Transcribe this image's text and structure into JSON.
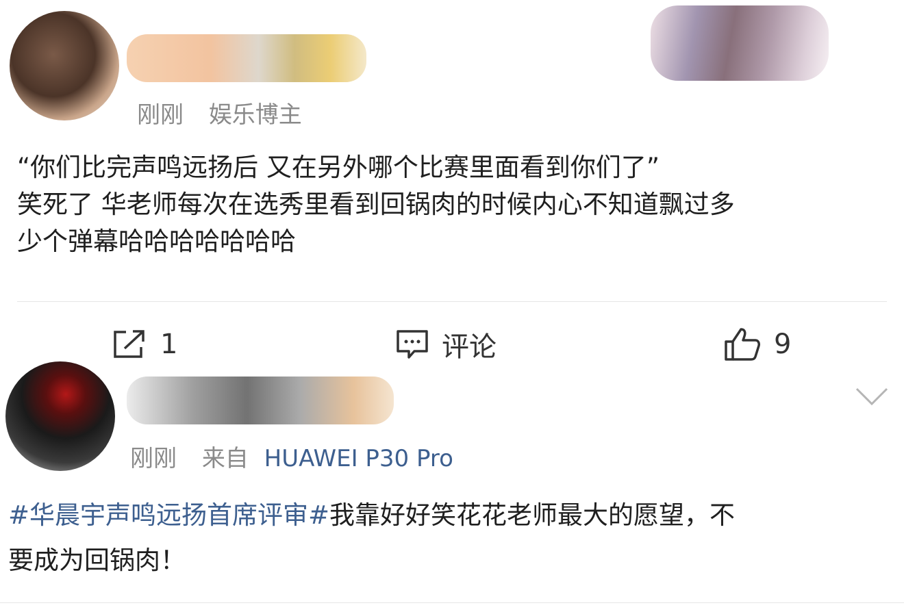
{
  "post1": {
    "meta_time": "刚刚",
    "meta_tag": "娱乐博主",
    "line1": "“你们比完声鸣远扬后 又在另外哪个比赛里面看到你们了”",
    "line2": "笑死了 华老师每次在选秀里看到回锅肉的时候内心不知道飘过多",
    "line3": "少个弹幕哈哈哈哈哈哈哈"
  },
  "actions": {
    "repost_count": "1",
    "comment_label": "评论",
    "like_count": "9"
  },
  "post2": {
    "meta_time": "刚刚",
    "meta_from": "来自",
    "meta_device": "HUAWEI P30 Pro",
    "topic": "#华晨宇声鸣远扬首席评审#",
    "text_after_topic": "我靠好好笑花花老师最大的愿望，不",
    "line2": "要成为回锅肉！"
  },
  "icons": [
    "repost-icon",
    "comment-icon",
    "like-icon",
    "chevron-down-icon"
  ],
  "colors": {
    "link": "#3d5f8f",
    "meta": "#8a8a8a",
    "text": "#1f1f1f"
  }
}
